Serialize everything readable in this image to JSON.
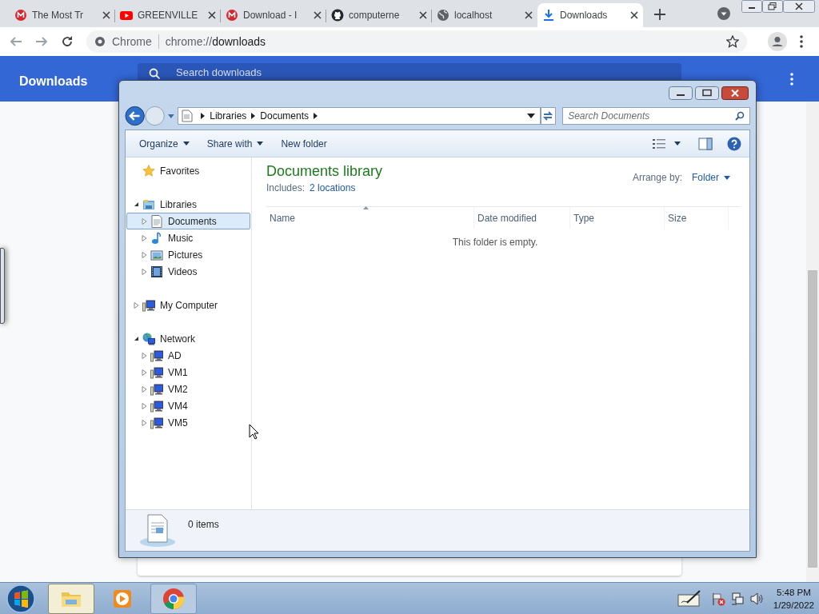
{
  "browser": {
    "tabs": [
      {
        "title": "The Most Tr",
        "kind": "mega",
        "selected": false
      },
      {
        "title": "GREENVILLE",
        "kind": "youtube",
        "selected": false
      },
      {
        "title": "Download - I",
        "kind": "mega",
        "selected": false
      },
      {
        "title": "computerne",
        "kind": "github",
        "selected": false
      },
      {
        "title": "localhost",
        "kind": "globe",
        "selected": false
      },
      {
        "title": "Downloads",
        "kind": "download",
        "selected": true
      }
    ],
    "omnibox": {
      "site": "Chrome",
      "url_prefix": "chrome://",
      "url_path": "downloads"
    }
  },
  "downloads_page": {
    "title": "Downloads",
    "search_placeholder": "Search downloads"
  },
  "explorer": {
    "breadcrumb": [
      "Libraries",
      "Documents"
    ],
    "search_placeholder": "Search Documents",
    "commands": [
      {
        "label": "Organize",
        "dropdown": true
      },
      {
        "label": "Share with",
        "dropdown": true
      },
      {
        "label": "New folder",
        "dropdown": false
      }
    ],
    "tree": [
      {
        "label": "Favorites",
        "kind": "star",
        "selected": false
      },
      {
        "label": "Libraries",
        "kind": "library",
        "expanded": true,
        "selected": false,
        "children": [
          {
            "label": "Documents",
            "kind": "documents",
            "expanded": false,
            "selected": true
          },
          {
            "label": "Music",
            "kind": "music",
            "expanded": false,
            "selected": false
          },
          {
            "label": "Pictures",
            "kind": "pictures",
            "expanded": false,
            "selected": false
          },
          {
            "label": "Videos",
            "kind": "videos",
            "expanded": false,
            "selected": false
          }
        ]
      },
      {
        "label": "My Computer",
        "kind": "computer",
        "expanded": false,
        "selected": false
      },
      {
        "label": "Network",
        "kind": "network",
        "expanded": true,
        "selected": false,
        "children": [
          {
            "label": "AD",
            "kind": "computer",
            "expanded": false,
            "selected": false
          },
          {
            "label": "VM1",
            "kind": "computer",
            "expanded": false,
            "selected": false
          },
          {
            "label": "VM2",
            "kind": "computer",
            "expanded": false,
            "selected": false
          },
          {
            "label": "VM4",
            "kind": "computer",
            "expanded": false,
            "selected": false
          },
          {
            "label": "VM5",
            "kind": "computer",
            "expanded": false,
            "selected": false
          }
        ]
      }
    ],
    "library_title": "Documents library",
    "includes_label": "Includes:",
    "includes_link": "2 locations",
    "arrange_label": "Arrange by:",
    "arrange_value": "Folder",
    "columns": [
      "Name",
      "Date modified",
      "Type",
      "Size"
    ],
    "empty_message": "This folder is empty.",
    "status": "0 items"
  },
  "taskbar": {
    "items": [
      {
        "kind": "explorer",
        "active": true
      },
      {
        "kind": "media",
        "active": false
      },
      {
        "kind": "chrome",
        "active": false
      }
    ],
    "time": "5:48 PM",
    "date": "1/29/2022"
  }
}
